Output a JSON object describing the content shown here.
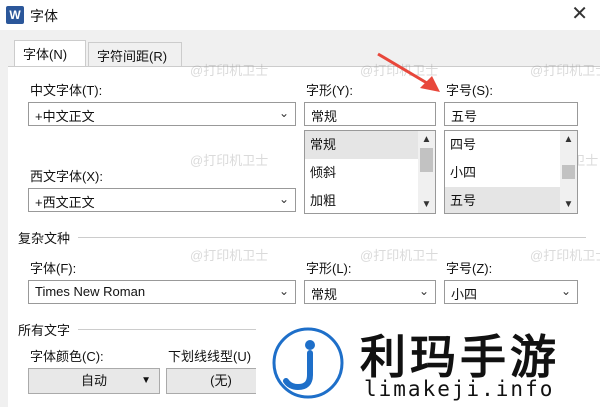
{
  "window": {
    "app_icon": "W",
    "title": "字体",
    "close": "✕"
  },
  "tabs": [
    {
      "label": "字体(N)"
    },
    {
      "label": "字符间距(R)"
    }
  ],
  "chinese_font": {
    "label": "中文字体(T):",
    "value": "+中文正文"
  },
  "style": {
    "label": "字形(Y):",
    "value": "常规",
    "options": [
      "常规",
      "倾斜",
      "加粗"
    ]
  },
  "size": {
    "label": "字号(S):",
    "value": "五号",
    "options": [
      "四号",
      "小四",
      "五号"
    ]
  },
  "western_font": {
    "label": "西文字体(X):",
    "value": "+西文正文"
  },
  "complex_script": {
    "section": "复杂文种",
    "font_label": "字体(F):",
    "font_value": "Times New Roman",
    "style_label": "字形(L):",
    "style_value": "常规",
    "size_label": "字号(Z):",
    "size_value": "小四"
  },
  "all_text": {
    "section": "所有文字",
    "color_label": "字体颜色(C):",
    "color_value": "自动",
    "underline_label": "下划线线型(U)",
    "underline_value": "(无)"
  },
  "watermark": "@打印机卫士",
  "logo": {
    "cn": "利玛手游",
    "en": "limakeji.info"
  },
  "colors": {
    "arrow": "#e8473b",
    "app_icon": "#2b579a",
    "logo_blue": "#1e6fc9"
  },
  "scrollbars": {
    "style_list": {
      "thumb_start": 0.0,
      "thumb_end": 0.5
    },
    "size_list": {
      "thumb_start": 0.35,
      "thumb_end": 0.65
    }
  }
}
